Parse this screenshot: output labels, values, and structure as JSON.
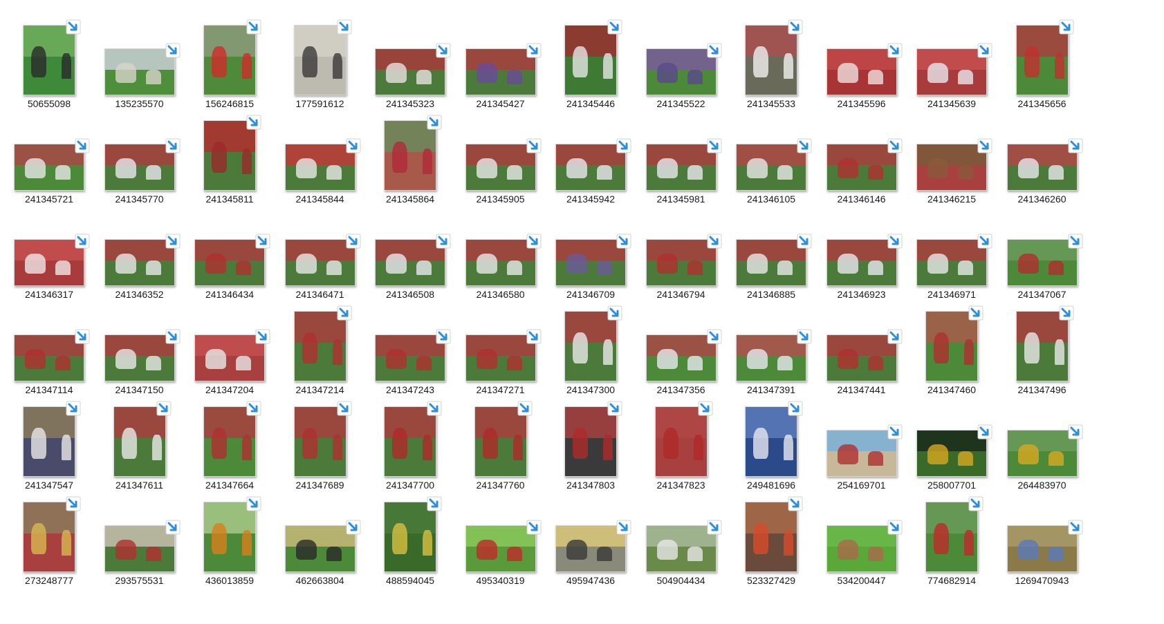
{
  "window": {
    "view": "Large icons"
  },
  "files": [
    {
      "name": "50655098",
      "orientation": "portrait",
      "colors": {
        "base": "#3f8a3a",
        "top": "#6fae5c",
        "figure": "#2b2b2b"
      }
    },
    {
      "name": "135235570",
      "orientation": "landscape",
      "colors": {
        "base": "#4f8f3c",
        "top": "#c9cfd6",
        "figure": "#d8d4c8"
      }
    },
    {
      "name": "156246815",
      "orientation": "portrait",
      "colors": {
        "base": "#4f8a3a",
        "top": "#8a9a7a",
        "figure": "#d22b2b"
      }
    },
    {
      "name": "177591612",
      "orientation": "portrait",
      "colors": {
        "base": "#bdbab0",
        "top": "#d4d1c6",
        "figure": "#3a3a3a"
      }
    },
    {
      "name": "241345323",
      "orientation": "landscape",
      "colors": {
        "base": "#4c7a3a",
        "top": "#a63b3b",
        "figure": "#e8e2e2"
      }
    },
    {
      "name": "241345427",
      "orientation": "landscape",
      "colors": {
        "base": "#4c7a3a",
        "top": "#a84040",
        "figure": "#6a4a9a"
      }
    },
    {
      "name": "241345446",
      "orientation": "portrait",
      "colors": {
        "base": "#3f7a35",
        "top": "#9a3030",
        "figure": "#e6e6e6"
      }
    },
    {
      "name": "241345522",
      "orientation": "landscape",
      "colors": {
        "base": "#4c8a3a",
        "top": "#7a5a9a",
        "figure": "#5a4a8a"
      }
    },
    {
      "name": "241345533",
      "orientation": "portrait",
      "colors": {
        "base": "#6a6a5a",
        "top": "#a85050",
        "figure": "#f0f0f0"
      }
    },
    {
      "name": "241345596",
      "orientation": "landscape",
      "colors": {
        "base": "#a83535",
        "top": "#c24848",
        "figure": "#f0e0e0"
      }
    },
    {
      "name": "241345639",
      "orientation": "landscape",
      "colors": {
        "base": "#a83b3b",
        "top": "#c45050",
        "figure": "#e8e8f0"
      }
    },
    {
      "name": "241345656",
      "orientation": "portrait",
      "colors": {
        "base": "#4c8a3a",
        "top": "#a84040",
        "figure": "#c23030"
      }
    },
    {
      "name": "241345721",
      "orientation": "landscape",
      "colors": {
        "base": "#4c8a3a",
        "top": "#a84848",
        "figure": "#e8e8e8"
      }
    },
    {
      "name": "241345770",
      "orientation": "landscape",
      "colors": {
        "base": "#4c7a3a",
        "top": "#a84040",
        "figure": "#e8e8f0"
      }
    },
    {
      "name": "241345811",
      "orientation": "portrait",
      "colors": {
        "base": "#4c7a3a",
        "top": "#b03030",
        "figure": "#9a2a2a"
      }
    },
    {
      "name": "241345844",
      "orientation": "landscape",
      "colors": {
        "base": "#4c7a3a",
        "top": "#c03a3a",
        "figure": "#e8e8e8"
      }
    },
    {
      "name": "241345864",
      "orientation": "portrait",
      "colors": {
        "base": "#a85a4a",
        "top": "#6a8a5a",
        "figure": "#b02a3a"
      }
    },
    {
      "name": "241345905",
      "orientation": "landscape",
      "colors": {
        "base": "#4c7a3a",
        "top": "#a84040",
        "figure": "#e8e8e8"
      }
    },
    {
      "name": "241345942",
      "orientation": "landscape",
      "colors": {
        "base": "#4c7a3a",
        "top": "#a84040",
        "figure": "#e8e8f0"
      }
    },
    {
      "name": "241345981",
      "orientation": "landscape",
      "colors": {
        "base": "#4c7a3a",
        "top": "#a84040",
        "figure": "#e8e8f0"
      }
    },
    {
      "name": "241346105",
      "orientation": "landscape",
      "colors": {
        "base": "#4c7a3a",
        "top": "#b04848",
        "figure": "#e8e8e8"
      }
    },
    {
      "name": "241346146",
      "orientation": "landscape",
      "colors": {
        "base": "#4c7a3a",
        "top": "#a84040",
        "figure": "#b03030"
      }
    },
    {
      "name": "241346215",
      "orientation": "landscape",
      "colors": {
        "base": "#a84040",
        "top": "#7a5a3a",
        "figure": "#8a5a3a"
      }
    },
    {
      "name": "241346260",
      "orientation": "landscape",
      "colors": {
        "base": "#4c7a3a",
        "top": "#b04848",
        "figure": "#e8e8f0"
      }
    },
    {
      "name": "241346317",
      "orientation": "landscape",
      "colors": {
        "base": "#a83b3b",
        "top": "#c45050",
        "figure": "#f0e8e8"
      }
    },
    {
      "name": "241346352",
      "orientation": "landscape",
      "colors": {
        "base": "#4c7a3a",
        "top": "#a84040",
        "figure": "#e8e8e8"
      }
    },
    {
      "name": "241346434",
      "orientation": "landscape",
      "colors": {
        "base": "#4c7a3a",
        "top": "#a84040",
        "figure": "#b03030"
      }
    },
    {
      "name": "241346471",
      "orientation": "landscape",
      "colors": {
        "base": "#4c7a3a",
        "top": "#a84040",
        "figure": "#e8e8e8"
      }
    },
    {
      "name": "241346508",
      "orientation": "landscape",
      "colors": {
        "base": "#4c7a3a",
        "top": "#a84040",
        "figure": "#e8e8f0"
      }
    },
    {
      "name": "241346580",
      "orientation": "landscape",
      "colors": {
        "base": "#4c7a3a",
        "top": "#a84040",
        "figure": "#e8e8e8"
      }
    },
    {
      "name": "241346709",
      "orientation": "landscape",
      "colors": {
        "base": "#4c7a3a",
        "top": "#a84040",
        "figure": "#6a5a9a"
      }
    },
    {
      "name": "241346794",
      "orientation": "landscape",
      "colors": {
        "base": "#4c7a3a",
        "top": "#a84040",
        "figure": "#b03030"
      }
    },
    {
      "name": "241346885",
      "orientation": "landscape",
      "colors": {
        "base": "#4c7a3a",
        "top": "#a84040",
        "figure": "#e8e8e8"
      }
    },
    {
      "name": "241346923",
      "orientation": "landscape",
      "colors": {
        "base": "#4c7a3a",
        "top": "#a84040",
        "figure": "#e8e8f0"
      }
    },
    {
      "name": "241346971",
      "orientation": "landscape",
      "colors": {
        "base": "#4c7a3a",
        "top": "#a84040",
        "figure": "#e8e8e8"
      }
    },
    {
      "name": "241347067",
      "orientation": "landscape",
      "colors": {
        "base": "#4c8a3a",
        "top": "#6a9a5a",
        "figure": "#b03030"
      }
    },
    {
      "name": "241347114",
      "orientation": "landscape",
      "colors": {
        "base": "#4c7a3a",
        "top": "#a84040",
        "figure": "#b03030"
      }
    },
    {
      "name": "241347150",
      "orientation": "landscape",
      "colors": {
        "base": "#4c7a3a",
        "top": "#a84040",
        "figure": "#e8e8e8"
      }
    },
    {
      "name": "241347204",
      "orientation": "landscape",
      "colors": {
        "base": "#a84040",
        "top": "#c45050",
        "figure": "#e8e8e8"
      }
    },
    {
      "name": "241347214",
      "orientation": "portrait",
      "colors": {
        "base": "#4c7a3a",
        "top": "#a84040",
        "figure": "#b03030"
      }
    },
    {
      "name": "241347243",
      "orientation": "landscape",
      "colors": {
        "base": "#4c7a3a",
        "top": "#a84040",
        "figure": "#b03030"
      }
    },
    {
      "name": "241347271",
      "orientation": "landscape",
      "colors": {
        "base": "#4c7a3a",
        "top": "#a84040",
        "figure": "#b03030"
      }
    },
    {
      "name": "241347300",
      "orientation": "portrait",
      "colors": {
        "base": "#4c7a3a",
        "top": "#a84040",
        "figure": "#e8e8e8"
      }
    },
    {
      "name": "241347356",
      "orientation": "landscape",
      "colors": {
        "base": "#4c8a3a",
        "top": "#a84848",
        "figure": "#e8e8f0"
      }
    },
    {
      "name": "241347391",
      "orientation": "landscape",
      "colors": {
        "base": "#4c8a3a",
        "top": "#b05050",
        "figure": "#e8e8f0"
      }
    },
    {
      "name": "241347441",
      "orientation": "landscape",
      "colors": {
        "base": "#4c7a3a",
        "top": "#a84040",
        "figure": "#b03030"
      }
    },
    {
      "name": "241347460",
      "orientation": "portrait",
      "colors": {
        "base": "#4c8a3a",
        "top": "#a85a4a",
        "figure": "#b03030"
      }
    },
    {
      "name": "241347496",
      "orientation": "portrait",
      "colors": {
        "base": "#4c7a3a",
        "top": "#a84040",
        "figure": "#e8e8e8"
      }
    },
    {
      "name": "241347547",
      "orientation": "portrait",
      "colors": {
        "base": "#4a4a6a",
        "top": "#8a7a5a",
        "figure": "#e8e8e8"
      }
    },
    {
      "name": "241347611",
      "orientation": "portrait",
      "colors": {
        "base": "#4c7a3a",
        "top": "#a84040",
        "figure": "#e8e8e8"
      }
    },
    {
      "name": "241347664",
      "orientation": "portrait",
      "colors": {
        "base": "#4c8a3a",
        "top": "#a84040",
        "figure": "#b03030"
      }
    },
    {
      "name": "241347689",
      "orientation": "portrait",
      "colors": {
        "base": "#4c7a3a",
        "top": "#a84040",
        "figure": "#b03030"
      }
    },
    {
      "name": "241347700",
      "orientation": "portrait",
      "colors": {
        "base": "#4c7a3a",
        "top": "#a84040",
        "figure": "#b02a2a"
      }
    },
    {
      "name": "241347760",
      "orientation": "portrait",
      "colors": {
        "base": "#4c7a3a",
        "top": "#a84040",
        "figure": "#b02a2a"
      }
    },
    {
      "name": "241347803",
      "orientation": "portrait",
      "colors": {
        "base": "#3a3a3a",
        "top": "#a84040",
        "figure": "#b02a2a"
      }
    },
    {
      "name": "241347823",
      "orientation": "portrait",
      "colors": {
        "base": "#a84040",
        "top": "#b04848",
        "figure": "#b02a2a"
      }
    },
    {
      "name": "249481696",
      "orientation": "portrait",
      "colors": {
        "base": "#2a4a8a",
        "top": "#5a7aba",
        "figure": "#e8e8f0"
      }
    },
    {
      "name": "254169701",
      "orientation": "landscape",
      "colors": {
        "base": "#c8b89a",
        "top": "#7ab0d8",
        "figure": "#b03030"
      }
    },
    {
      "name": "258007701",
      "orientation": "landscape",
      "colors": {
        "base": "#3a6a2a",
        "top": "#1a2a1a",
        "figure": "#d8a820"
      }
    },
    {
      "name": "264483970",
      "orientation": "landscape",
      "colors": {
        "base": "#4c8a3a",
        "top": "#6a9a5a",
        "figure": "#d8a820"
      }
    },
    {
      "name": "273248777",
      "orientation": "portrait",
      "colors": {
        "base": "#a84040",
        "top": "#8a7a5a",
        "figure": "#d8b850"
      }
    },
    {
      "name": "293575531",
      "orientation": "landscape",
      "colors": {
        "base": "#4c7a3a",
        "top": "#c8c0b0",
        "figure": "#b03030"
      }
    },
    {
      "name": "436013859",
      "orientation": "portrait",
      "colors": {
        "base": "#4c8a3a",
        "top": "#a8c88a",
        "figure": "#d8801a"
      }
    },
    {
      "name": "462663804",
      "orientation": "landscape",
      "colors": {
        "base": "#4c8a3a",
        "top": "#c8b87a",
        "figure": "#2a2a2a"
      }
    },
    {
      "name": "488594045",
      "orientation": "portrait",
      "colors": {
        "base": "#3a6a2a",
        "top": "#4a7a3a",
        "figure": "#d8c040"
      }
    },
    {
      "name": "495340319",
      "orientation": "landscape",
      "colors": {
        "base": "#5a9a3a",
        "top": "#8ac85a",
        "figure": "#c02a2a"
      }
    },
    {
      "name": "495947436",
      "orientation": "landscape",
      "colors": {
        "base": "#8a8a7a",
        "top": "#d8c87a",
        "figure": "#3a3a3a"
      }
    },
    {
      "name": "504904434",
      "orientation": "landscape",
      "colors": {
        "base": "#6a8a4a",
        "top": "#a8b89a",
        "figure": "#e8e8e8"
      }
    },
    {
      "name": "523327429",
      "orientation": "portrait",
      "colors": {
        "base": "#6a4a3a",
        "top": "#a86a4a",
        "figure": "#d84a2a"
      }
    },
    {
      "name": "534200447",
      "orientation": "landscape",
      "colors": {
        "base": "#5aa83a",
        "top": "#6ab84a",
        "figure": "#a86a4a"
      }
    },
    {
      "name": "774682914",
      "orientation": "portrait",
      "colors": {
        "base": "#4c8a3a",
        "top": "#6a9a5a",
        "figure": "#c02a2a"
      }
    },
    {
      "name": "1269470943",
      "orientation": "landscape",
      "colors": {
        "base": "#8a7a4a",
        "top": "#a89a6a",
        "figure": "#5a7ab8"
      }
    }
  ],
  "icons": {
    "shortcut_overlay": "shortcut-arrow-icon",
    "shortcut_color": "#2b8fe0"
  }
}
